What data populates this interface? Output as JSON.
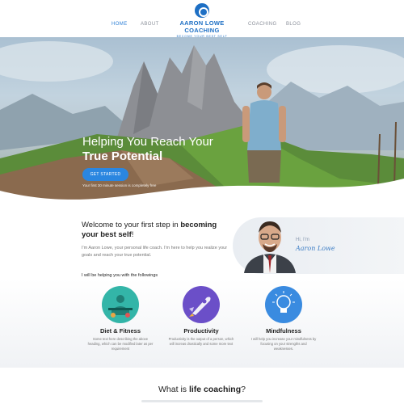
{
  "nav": {
    "items": [
      {
        "label": "HOME",
        "active": true
      },
      {
        "label": "ABOUT",
        "active": false
      },
      {
        "label": "COACHING",
        "active": false
      },
      {
        "label": "BLOG",
        "active": false
      }
    ],
    "logo_title": "AARON LOWE COACHING",
    "logo_tagline": "BECOME YOUR BEST SELF"
  },
  "hero": {
    "title_line1": "Helping You Reach Your",
    "title_line2": "True Potential",
    "button_label": "GET STARTED",
    "caption": "Your first 30 minute session is completely free"
  },
  "intro": {
    "heading_part1": "Welcome to your first step in ",
    "heading_bold1": "becoming",
    "heading_bold2": "your best self",
    "heading_end": "!",
    "body": "I'm Aaron Lowe, your personal life coach. I'm here to help you realize your goals and reach your true potential.",
    "subheading": "I will be helping you with the followings",
    "greeting": "Hi, I'm",
    "name": "Aaron Lowe"
  },
  "features": [
    {
      "title": "Diet & Fitness",
      "description": "Some text here describing the above heading, which can be modified later as per requirement",
      "icon": "fitness-icon",
      "color": "#33b5a8"
    },
    {
      "title": "Productivity",
      "description": "Productivity is the output of a person, which will increas drastically and some more text",
      "icon": "rocket-icon",
      "color": "#6b4fc8"
    },
    {
      "title": "Mindfulness",
      "description": "I will help you increase your mindfulness by focusing on your strengths and weaknesses.",
      "icon": "lightbulb-icon",
      "color": "#3a8be0"
    }
  ],
  "bottom": {
    "heading_part1": "What is ",
    "heading_bold": "life coaching",
    "heading_end": "?"
  },
  "colors": {
    "accent": "#2a86e0",
    "brand": "#1d6fc4"
  }
}
